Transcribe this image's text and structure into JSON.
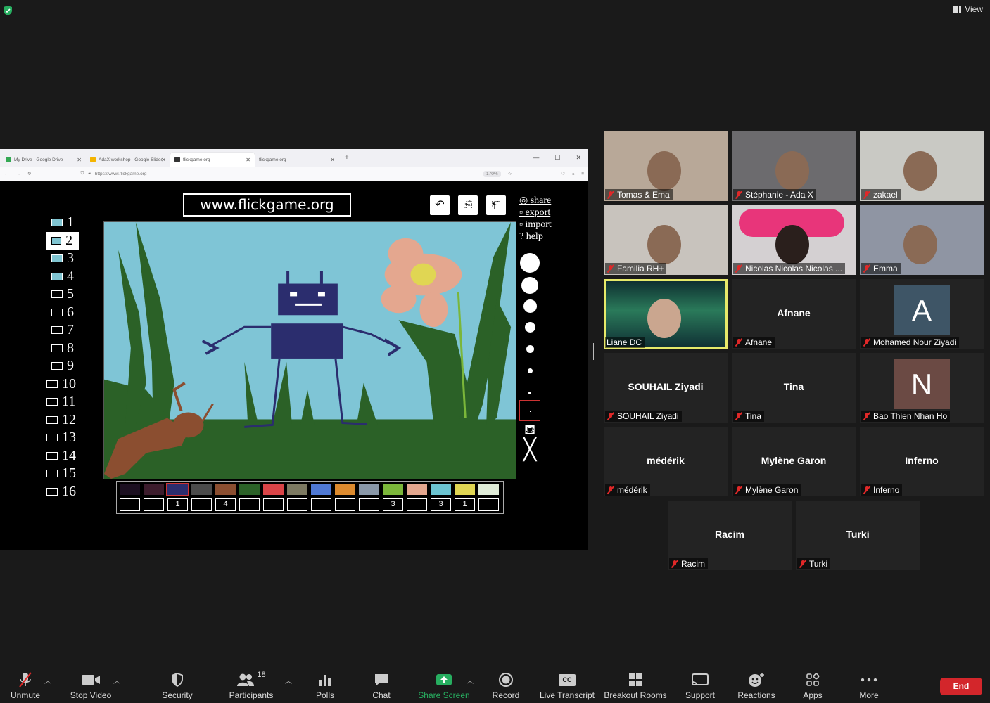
{
  "topbar": {
    "view_label": "View"
  },
  "browser": {
    "tabs": [
      {
        "label": "My Drive - Google Drive",
        "color": "#34a853"
      },
      {
        "label": "AdaX workshop - Google Slides",
        "color": "#f4b400"
      },
      {
        "label": "flickgame.org",
        "color": "#333333"
      },
      {
        "label": "flickgame.org",
        "color": "#ffffff"
      }
    ],
    "new_tab": "+",
    "url": "https://www.flickgame.org",
    "zoom": "170%"
  },
  "flickgame": {
    "title": "www.flickgame.org",
    "menu": [
      "share",
      "export",
      "import",
      "? help"
    ],
    "frames": [
      "1",
      "2",
      "3",
      "4",
      "5",
      "6",
      "7",
      "8",
      "9",
      "10",
      "11",
      "12",
      "13",
      "14",
      "15",
      "16"
    ],
    "palette": [
      "#1b0f20",
      "#3c1c2c",
      "#2b2d6e",
      "#4b4b4b",
      "#8b4e30",
      "#2b6127",
      "#d94447",
      "#7c7961",
      "#4f79d4",
      "#dc8a2e",
      "#8a98a8",
      "#7bb63a",
      "#e4a78f",
      "#6cc4d1",
      "#e0d653",
      "#e0ecd8"
    ],
    "counts": [
      "",
      "",
      "1",
      "",
      "4",
      "",
      "",
      "",
      "",
      "",
      "",
      "3",
      "",
      "3",
      "1",
      ""
    ]
  },
  "participants": [
    {
      "name": "Tomas & Ema",
      "video": true,
      "muted": true
    },
    {
      "name": "Stéphanie - Ada X",
      "video": true,
      "muted": true
    },
    {
      "name": "zakael",
      "video": true,
      "muted": true
    },
    {
      "name": "Familia RH+",
      "video": true,
      "muted": true
    },
    {
      "name": "Nicolas Nicolas Nicolas ...",
      "video": true,
      "muted": true
    },
    {
      "name": "Emma",
      "video": true,
      "muted": true
    },
    {
      "name": "Liane DC",
      "video": true,
      "muted": false
    },
    {
      "name": "Afnane",
      "display": "Afnane",
      "muted": true
    },
    {
      "name": "Mohamed Nour Ziyadi",
      "avatar": "A",
      "muted": true
    },
    {
      "name": "SOUHAIL  Ziyadi",
      "display": "SOUHAIL  Ziyadi",
      "muted": true
    },
    {
      "name": "Tina",
      "display": "Tina",
      "muted": true
    },
    {
      "name": "Bao Thien Nhan Ho",
      "avatar": "N",
      "muted": true
    },
    {
      "name": "médérik",
      "display": "médérik",
      "muted": true
    },
    {
      "name": "Mylène Garon",
      "display": "Mylène Garon",
      "muted": true
    },
    {
      "name": "Inferno",
      "display": "Inferno",
      "muted": true
    },
    {
      "name": "Racim",
      "display": "Racim",
      "muted": true
    },
    {
      "name": "Turki",
      "display": "Turki",
      "muted": true
    }
  ],
  "toolbar": {
    "unmute": "Unmute",
    "stop_video": "Stop Video",
    "security": "Security",
    "participants": "Participants",
    "participants_count": "18",
    "polls": "Polls",
    "chat": "Chat",
    "share_screen": "Share Screen",
    "record": "Record",
    "live_transcript": "Live Transcript",
    "breakout_rooms": "Breakout Rooms",
    "support": "Support",
    "reactions": "Reactions",
    "apps": "Apps",
    "more": "More",
    "end": "End",
    "cc": "CC"
  },
  "colors": {
    "accent_green": "#27ae60",
    "end_red": "#d3262b",
    "speaker_outline": "#e6e96a"
  }
}
